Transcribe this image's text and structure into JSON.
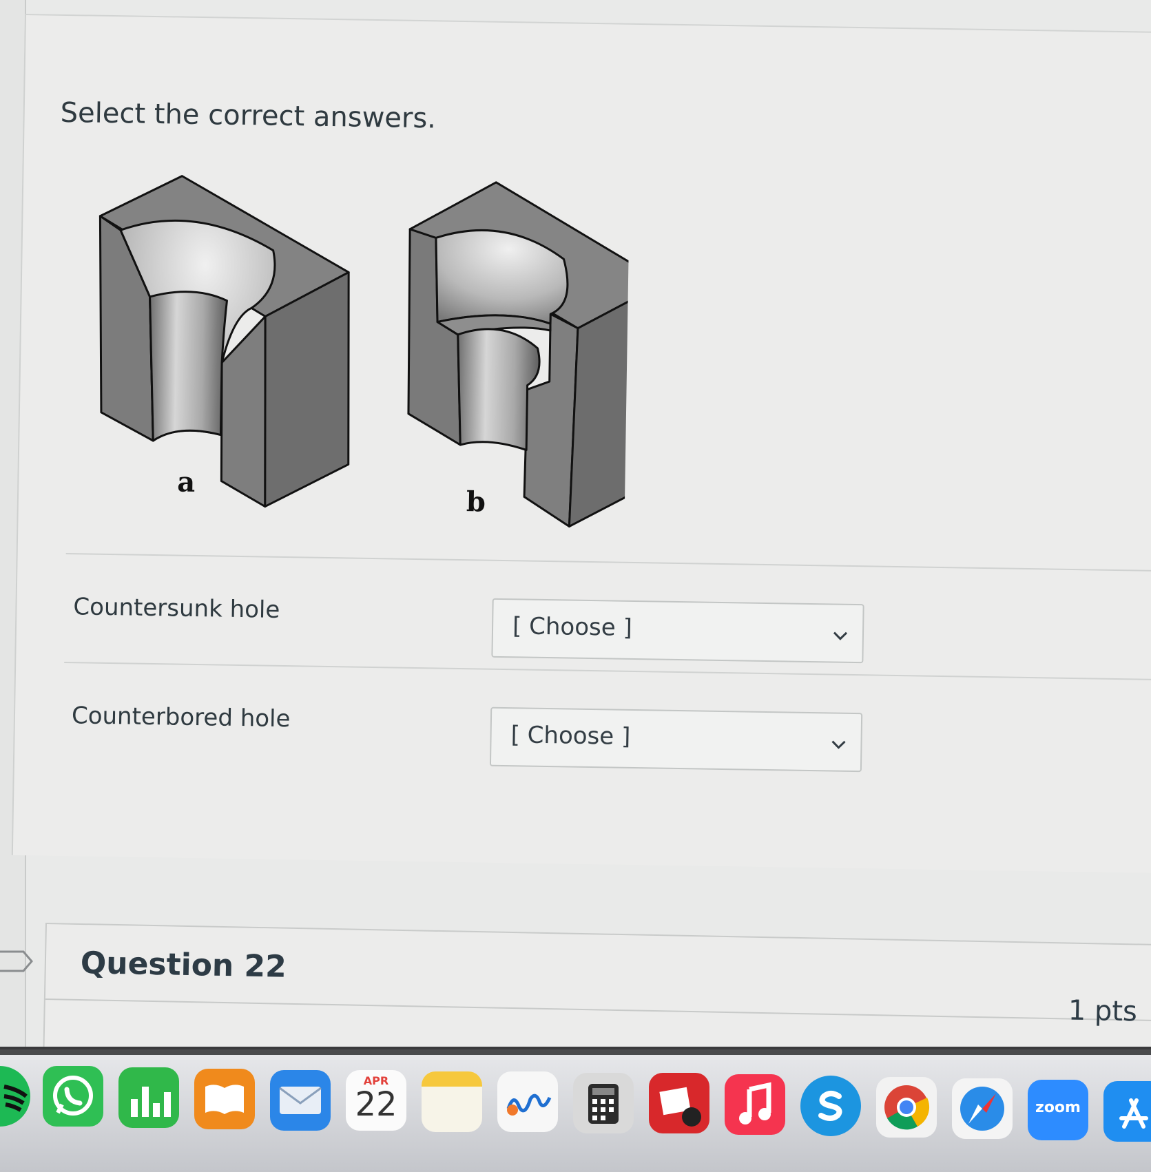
{
  "quiz": {
    "prompt": "Select the correct answers.",
    "figure": {
      "label_a": "a",
      "label_b": "b"
    },
    "rows": [
      {
        "label": "Countersunk hole",
        "select_value": "[ Choose ]"
      },
      {
        "label": "Counterbored hole",
        "select_value": "[ Choose ]"
      }
    ]
  },
  "next_question": {
    "title": "Question 22",
    "points": "1 pts"
  },
  "dock": {
    "apps": [
      "spotify-icon",
      "whatsapp-icon",
      "numbers-icon",
      "books-icon",
      "mail-icon",
      "calendar-icon",
      "notes-icon",
      "freeform-icon",
      "calculator-icon",
      "photo-booth-icon",
      "music-icon",
      "skype-icon",
      "chrome-icon",
      "safari-icon",
      "zoom-icon",
      "app-store-icon"
    ],
    "calendar_month": "APR",
    "calendar_day": "22",
    "zoom_label": "zoom"
  },
  "colors": {
    "page_bg": "#e9eae9",
    "text": "#2d3b45",
    "select_border": "#c3c6c5"
  }
}
